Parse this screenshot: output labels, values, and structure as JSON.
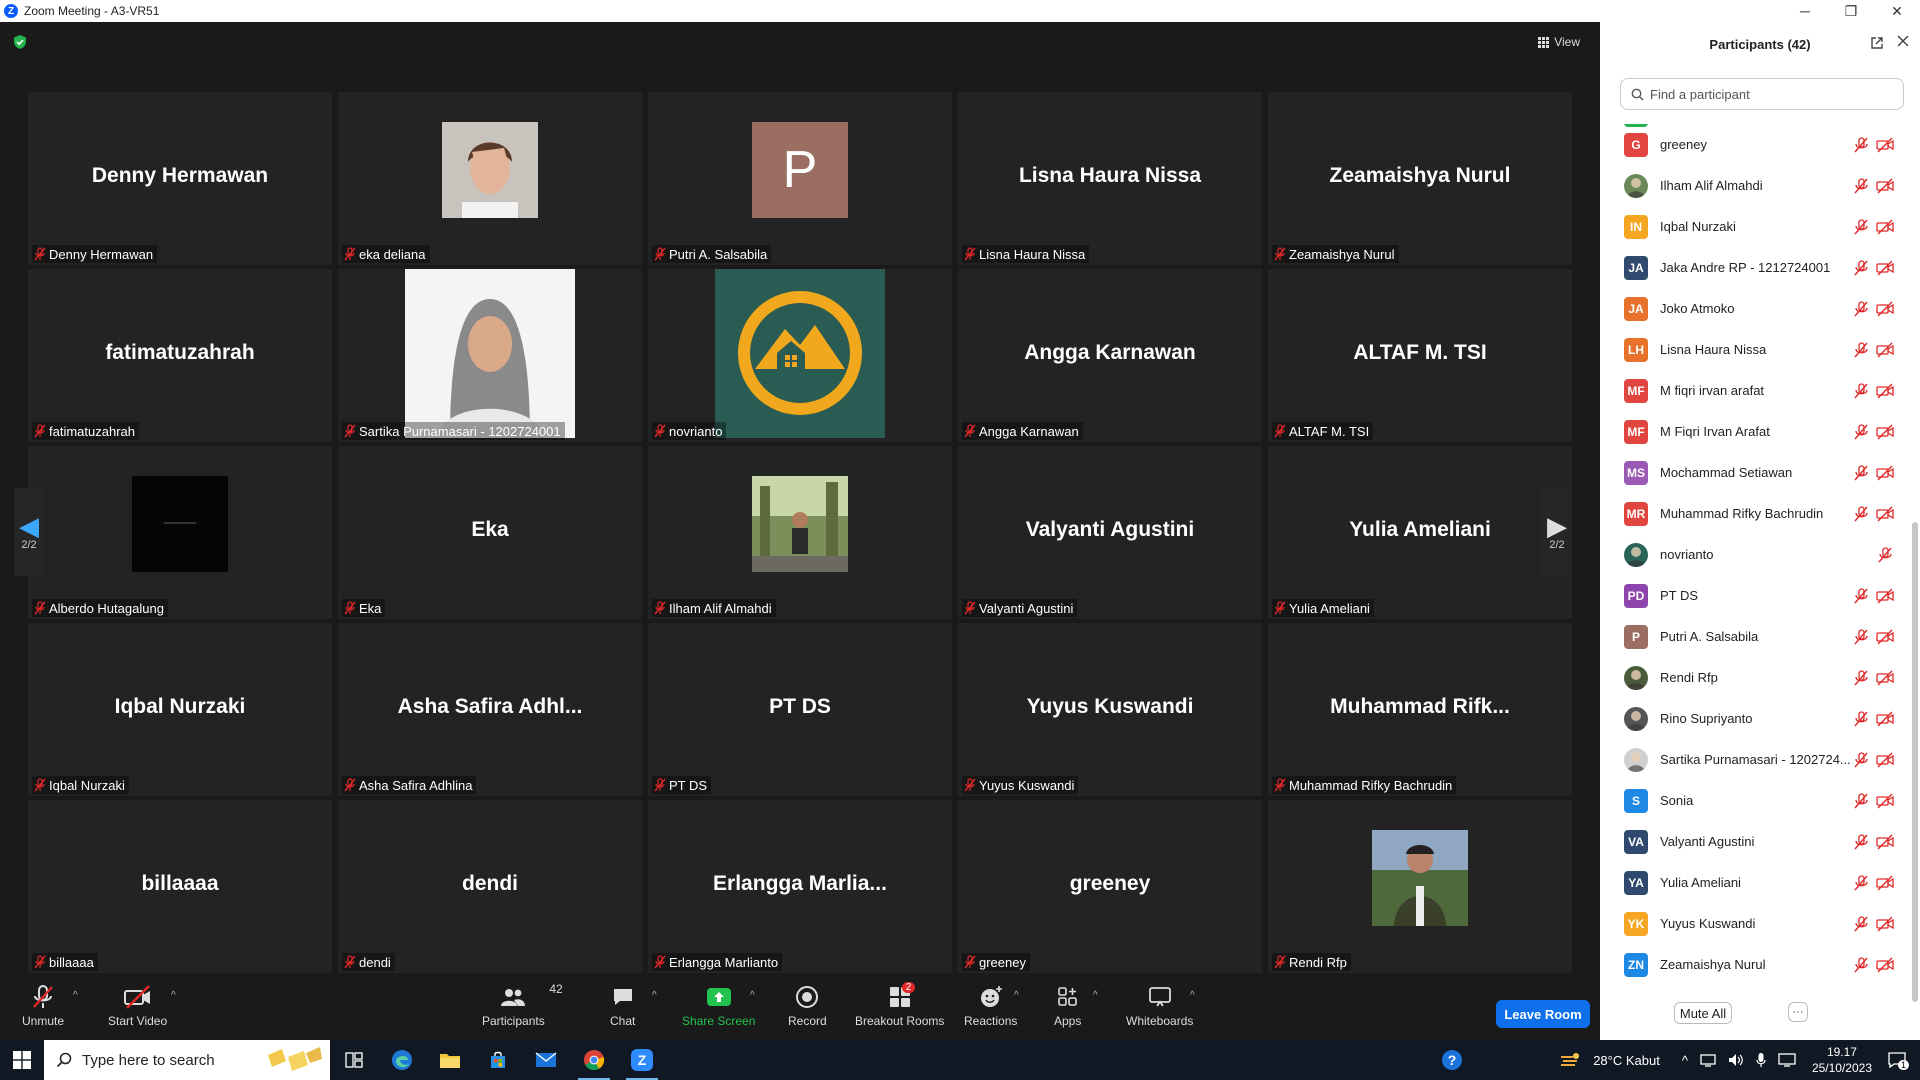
{
  "window": {
    "title": "Zoom Meeting - A3-VR51",
    "minimize": "─",
    "maximize": "❐",
    "close": "✕"
  },
  "meeting": {
    "view_label": "View",
    "page_left": "2/2",
    "page_right": "2/2"
  },
  "tiles": [
    {
      "label": "Denny Hermawan",
      "big": "Denny Hermawan"
    },
    {
      "label": "eka deliana",
      "big": "",
      "photo": "portrait-girl"
    },
    {
      "label": "Putri A. Salsabila",
      "big": "",
      "initial": "P",
      "color": "#9a6f61"
    },
    {
      "label": "Lisna Haura Nissa",
      "big": "Lisna Haura Nissa"
    },
    {
      "label": "Zeamaishya Nurul",
      "big": "Zeamaishya Nurul"
    },
    {
      "label": "fatimatuzahrah",
      "big": "fatimatuzahrah"
    },
    {
      "label": "Sartika Purnamasari - 1202724001",
      "big": "",
      "photo": "hijab-portrait"
    },
    {
      "label": "novrianto",
      "big": "",
      "photo": "house-logo"
    },
    {
      "label": "Angga Karnawan",
      "big": "Angga Karnawan"
    },
    {
      "label": "ALTAF M. TSI",
      "big": "ALTAF M. TSI"
    },
    {
      "label": "Alberdo Hutagalung",
      "big": "",
      "photo": "black-image"
    },
    {
      "label": "Eka",
      "big": "Eka"
    },
    {
      "label": "Ilham Alif Almahdi",
      "big": "",
      "photo": "outdoor-man"
    },
    {
      "label": "Valyanti Agustini",
      "big": "Valyanti Agustini"
    },
    {
      "label": "Yulia Ameliani",
      "big": "Yulia Ameliani"
    },
    {
      "label": "Iqbal Nurzaki",
      "big": "Iqbal Nurzaki"
    },
    {
      "label": "Asha Safira Adhlina",
      "big": "Asha Safira Adhl..."
    },
    {
      "label": "PT DS",
      "big": "PT DS"
    },
    {
      "label": "Yuyus Kuswandi",
      "big": "Yuyus Kuswandi"
    },
    {
      "label": "Muhammad Rifky Bachrudin",
      "big": "Muhammad  Rifk..."
    },
    {
      "label": "billaaaa",
      "big": "billaaaa"
    },
    {
      "label": "dendi",
      "big": "dendi"
    },
    {
      "label": "Erlangga Marlianto",
      "big": "Erlangga  Marlia..."
    },
    {
      "label": "greeney",
      "big": "greeney"
    },
    {
      "label": "Rendi Rfp",
      "big": "",
      "photo": "man-jacket"
    }
  ],
  "toolbar": {
    "unmute": "Unmute",
    "start_video": "Start Video",
    "participants": "Participants",
    "participants_count": "42",
    "chat": "Chat",
    "share_screen": "Share Screen",
    "record": "Record",
    "breakout": "Breakout Rooms",
    "breakout_badge": "2",
    "reactions": "Reactions",
    "apps": "Apps",
    "whiteboards": "Whiteboards",
    "leave": "Leave Room"
  },
  "panel": {
    "title": "Participants (42)",
    "search_placeholder": "Find a participant",
    "mute_all": "Mute All",
    "more": "···",
    "participants": [
      {
        "name": "greeney",
        "initials": "G",
        "color": "#e0463f",
        "video_off": true
      },
      {
        "name": "Ilham Alif Almahdi",
        "initials": "",
        "color": "#6b8a5a",
        "photo": true,
        "video_off": true
      },
      {
        "name": "Iqbal Nurzaki",
        "initials": "IN",
        "color": "#f5a623",
        "video_off": true
      },
      {
        "name": "Jaka Andre RP - 1212724001",
        "initials": "JA",
        "color": "#2f4a6e",
        "video_off": true
      },
      {
        "name": "Joko Atmoko",
        "initials": "JA",
        "color": "#e8722b",
        "video_off": true
      },
      {
        "name": "Lisna Haura Nissa",
        "initials": "LH",
        "color": "#e8722b",
        "video_off": true
      },
      {
        "name": "M fiqri irvan arafat",
        "initials": "MF",
        "color": "#e0463f",
        "video_off": true
      },
      {
        "name": "M Fiqri Irvan Arafat",
        "initials": "MF",
        "color": "#e0463f",
        "video_off": true
      },
      {
        "name": "Mochammad Setiawan",
        "initials": "MS",
        "color": "#9b59b6",
        "video_off": true
      },
      {
        "name": "Muhammad Rifky Bachrudin",
        "initials": "MR",
        "color": "#e0463f",
        "video_off": true
      },
      {
        "name": "novrianto",
        "initials": "",
        "color": "#2a6458",
        "photo": true,
        "video_off": false
      },
      {
        "name": "PT DS",
        "initials": "PD",
        "color": "#8e44ad",
        "video_off": true
      },
      {
        "name": "Putri A. Salsabila",
        "initials": "P",
        "color": "#9a6f61",
        "video_off": true
      },
      {
        "name": "Rendi Rfp",
        "initials": "",
        "color": "#4a5b3a",
        "photo": true,
        "video_off": true
      },
      {
        "name": "Rino Supriyanto",
        "initials": "",
        "color": "#555555",
        "photo": true,
        "video_off": true
      },
      {
        "name": "Sartika Purnamasari - 1202724...",
        "initials": "",
        "color": "#cfcfcf",
        "photo": true,
        "video_off": true
      },
      {
        "name": "Sonia",
        "initials": "S",
        "color": "#1e88e5",
        "video_off": true
      },
      {
        "name": "Valyanti Agustini",
        "initials": "VA",
        "color": "#2f4a6e",
        "video_off": true
      },
      {
        "name": "Yulia Ameliani",
        "initials": "YA",
        "color": "#2f4a6e",
        "video_off": true
      },
      {
        "name": "Yuyus Kuswandi",
        "initials": "YK",
        "color": "#f5a623",
        "video_off": true
      },
      {
        "name": "Zeamaishya Nurul",
        "initials": "ZN",
        "color": "#1e88e5",
        "video_off": true
      }
    ]
  },
  "taskbar": {
    "search_placeholder": "Type here to search",
    "weather": "28°C  Kabut",
    "time": "19.17",
    "date": "25/10/2023",
    "notif_count": "1"
  }
}
